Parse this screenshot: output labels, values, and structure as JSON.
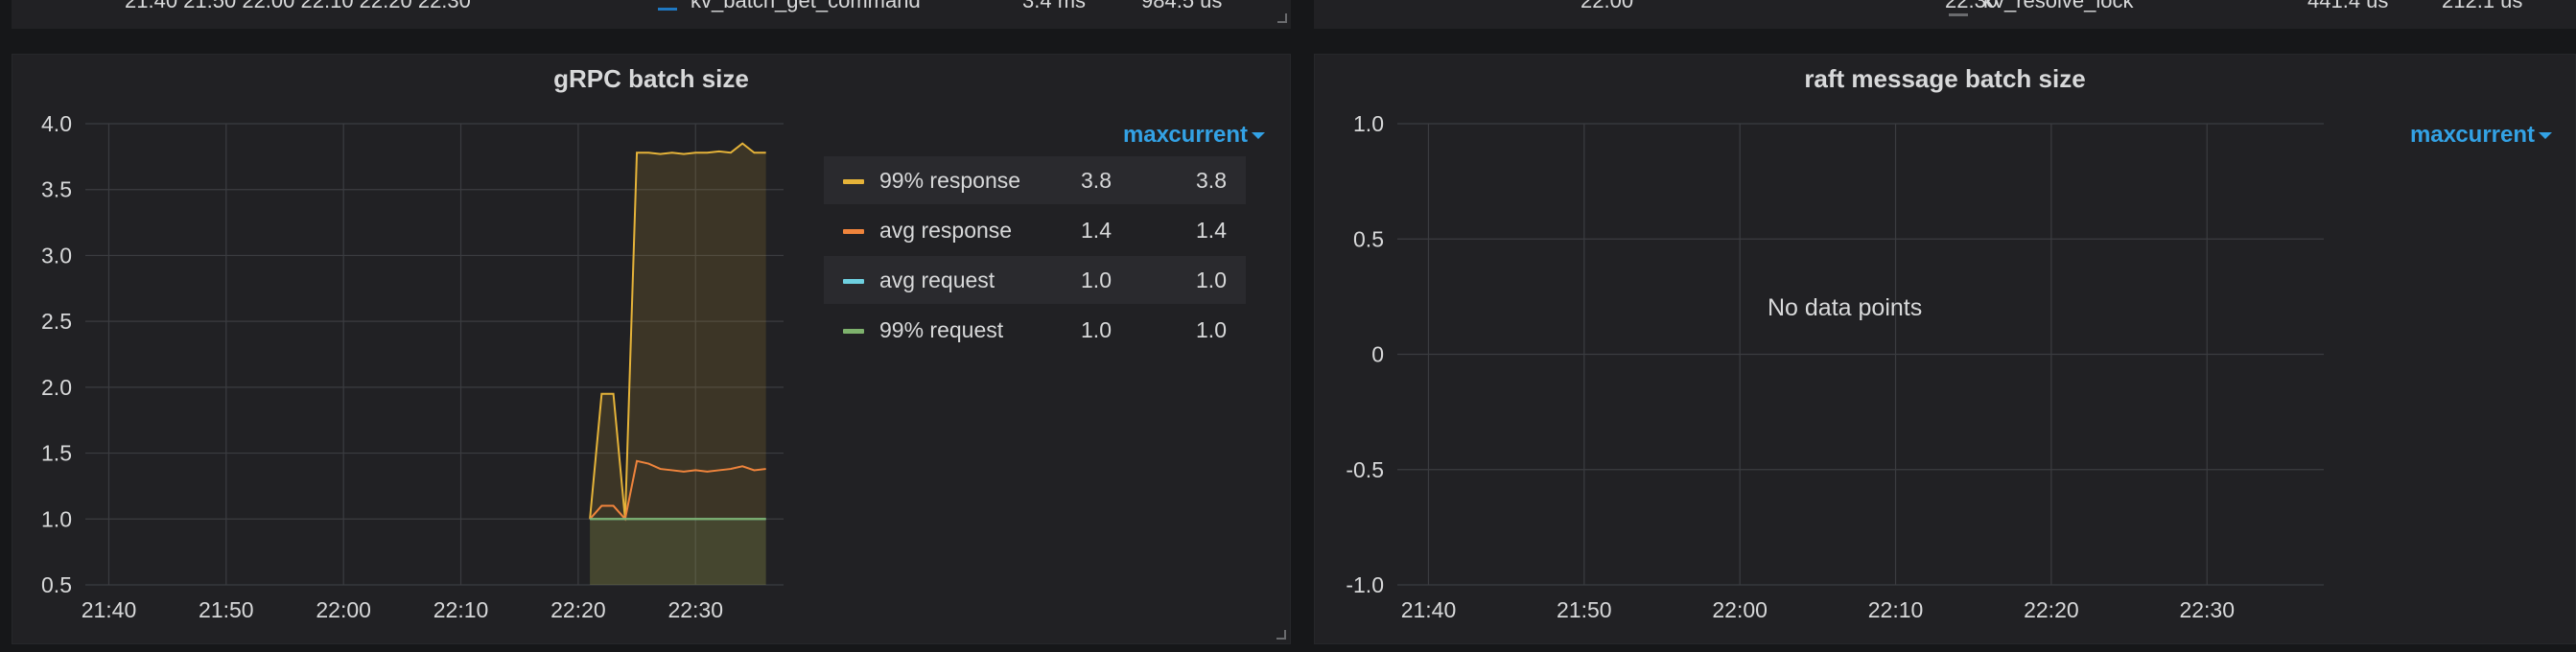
{
  "top_remnant": {
    "left_times": "21:40   21:50   22:00   22:10   22:20   22:30",
    "left_legend_name": "kv_batch_get_command",
    "left_legend_max": "3.4 ms",
    "left_legend_current": "984.5 us",
    "right_time_a": "22:00",
    "right_time_b": "22:30",
    "right_legend_name": "kv_resolve_lock",
    "right_legend_max": "441.4 us",
    "right_legend_current": "212.1 us"
  },
  "panels": [
    {
      "title": "gRPC batch size",
      "legend_header": {
        "max": "max",
        "current": "current"
      },
      "legend": [
        {
          "name": "99% response",
          "max": "3.8",
          "current": "3.8",
          "color": "#e5b339"
        },
        {
          "name": "avg response",
          "max": "1.4",
          "current": "1.4",
          "color": "#ef843c"
        },
        {
          "name": "avg request",
          "max": "1.0",
          "current": "1.0",
          "color": "#6ed0e0"
        },
        {
          "name": "99% request",
          "max": "1.0",
          "current": "1.0",
          "color": "#7eb26d"
        }
      ]
    },
    {
      "title": "raft message batch size",
      "legend_header": {
        "max": "max",
        "current": "current"
      },
      "no_data": "No data points"
    }
  ],
  "chart_data": [
    {
      "type": "line",
      "title": "gRPC batch size",
      "x_ticks": [
        "21:40",
        "21:50",
        "22:00",
        "22:10",
        "22:20",
        "22:30"
      ],
      "y_ticks": [
        "4.0",
        "3.5",
        "3.0",
        "2.5",
        "2.0",
        "1.5",
        "1.0",
        "0.5"
      ],
      "ylim": [
        0.5,
        4.0
      ],
      "grid": true,
      "legend_placement": "right",
      "series": [
        {
          "name": "99% response",
          "color": "#e5b339",
          "fill": true,
          "x": [
            "22:21",
            "22:22",
            "22:23",
            "22:24",
            "22:25",
            "22:26",
            "22:27",
            "22:28",
            "22:29",
            "22:30",
            "22:31",
            "22:32",
            "22:33",
            "22:34",
            "22:35",
            "22:36"
          ],
          "values": [
            1.0,
            1.95,
            1.95,
            1.0,
            3.78,
            3.78,
            3.77,
            3.78,
            3.77,
            3.78,
            3.78,
            3.79,
            3.78,
            3.85,
            3.78,
            3.78
          ]
        },
        {
          "name": "avg response",
          "color": "#ef843c",
          "fill": false,
          "x": [
            "22:21",
            "22:22",
            "22:23",
            "22:24",
            "22:25",
            "22:26",
            "22:27",
            "22:28",
            "22:29",
            "22:30",
            "22:31",
            "22:32",
            "22:33",
            "22:34",
            "22:35",
            "22:36"
          ],
          "values": [
            1.0,
            1.1,
            1.1,
            1.0,
            1.44,
            1.42,
            1.38,
            1.37,
            1.36,
            1.37,
            1.36,
            1.37,
            1.38,
            1.4,
            1.37,
            1.38
          ]
        },
        {
          "name": "avg request",
          "color": "#6ed0e0",
          "fill": false,
          "x": [
            "22:21",
            "22:36"
          ],
          "values": [
            1.0,
            1.0
          ]
        },
        {
          "name": "99% request",
          "color": "#7eb26d",
          "fill": true,
          "x": [
            "22:21",
            "22:36"
          ],
          "values": [
            1.0,
            1.0
          ]
        }
      ]
    },
    {
      "type": "line",
      "title": "raft message batch size",
      "x_ticks": [
        "21:40",
        "21:50",
        "22:00",
        "22:10",
        "22:20",
        "22:30"
      ],
      "y_ticks": [
        "1.0",
        "0.5",
        "0",
        "-0.5",
        "-1.0"
      ],
      "ylim": [
        -1.0,
        1.0
      ],
      "grid": true,
      "series": []
    }
  ]
}
